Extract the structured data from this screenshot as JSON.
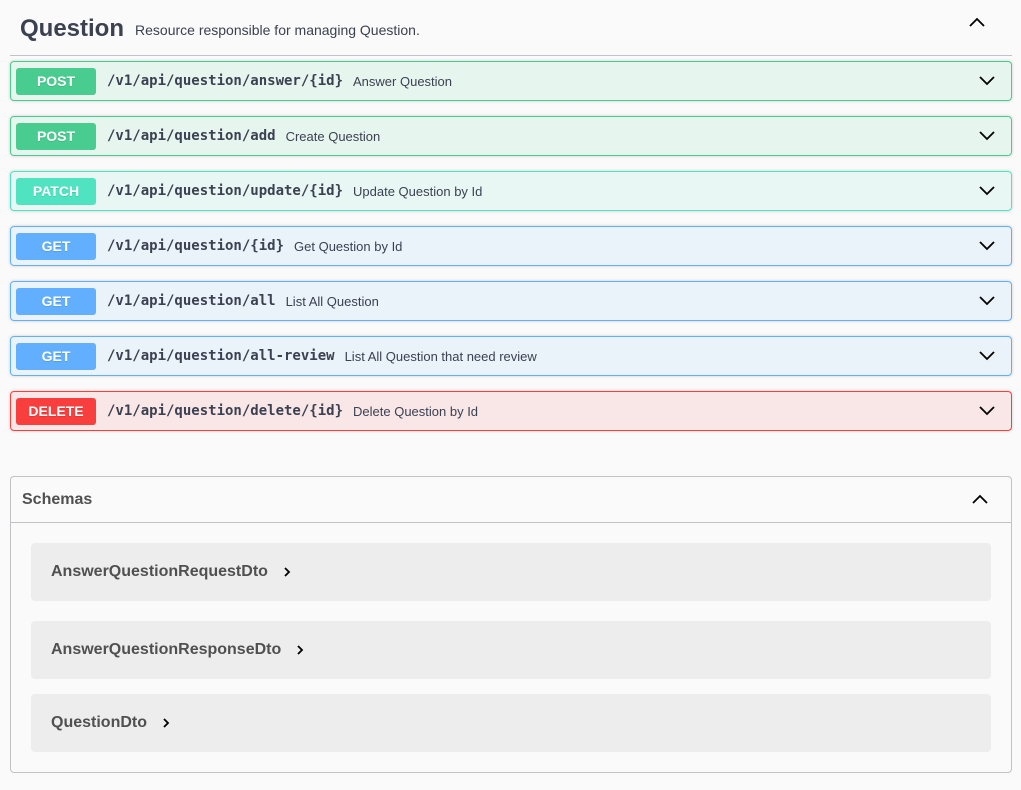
{
  "tag": {
    "title": "Question",
    "description": "Resource responsible for managing Question."
  },
  "operations": [
    {
      "method": "POST",
      "path": "/v1/api/question/answer/{id}",
      "summary": "Answer Question"
    },
    {
      "method": "POST",
      "path": "/v1/api/question/add",
      "summary": "Create Question"
    },
    {
      "method": "PATCH",
      "path": "/v1/api/question/update/{id}",
      "summary": "Update Question by Id"
    },
    {
      "method": "GET",
      "path": "/v1/api/question/{id}",
      "summary": "Get Question by Id"
    },
    {
      "method": "GET",
      "path": "/v1/api/question/all",
      "summary": "List All Question"
    },
    {
      "method": "GET",
      "path": "/v1/api/question/all-review",
      "summary": "List All Question that need review"
    },
    {
      "method": "DELETE",
      "path": "/v1/api/question/delete/{id}",
      "summary": "Delete Question by Id"
    }
  ],
  "schemas": {
    "title": "Schemas",
    "models": [
      {
        "name": "AnswerQuestionRequestDto"
      },
      {
        "name": "AnswerQuestionResponseDto"
      },
      {
        "name": "QuestionDto"
      }
    ]
  },
  "colors": {
    "post": "#49cc90",
    "patch": "#50e3c2",
    "get": "#61affe",
    "delete": "#f93e3e",
    "text": "#3b4151"
  },
  "icons": {
    "tag_toggle": "chevron-up-icon",
    "operation_toggle": "chevron-down-icon",
    "schemas_toggle": "chevron-up-icon",
    "model_expand": "chevron-right-icon"
  }
}
